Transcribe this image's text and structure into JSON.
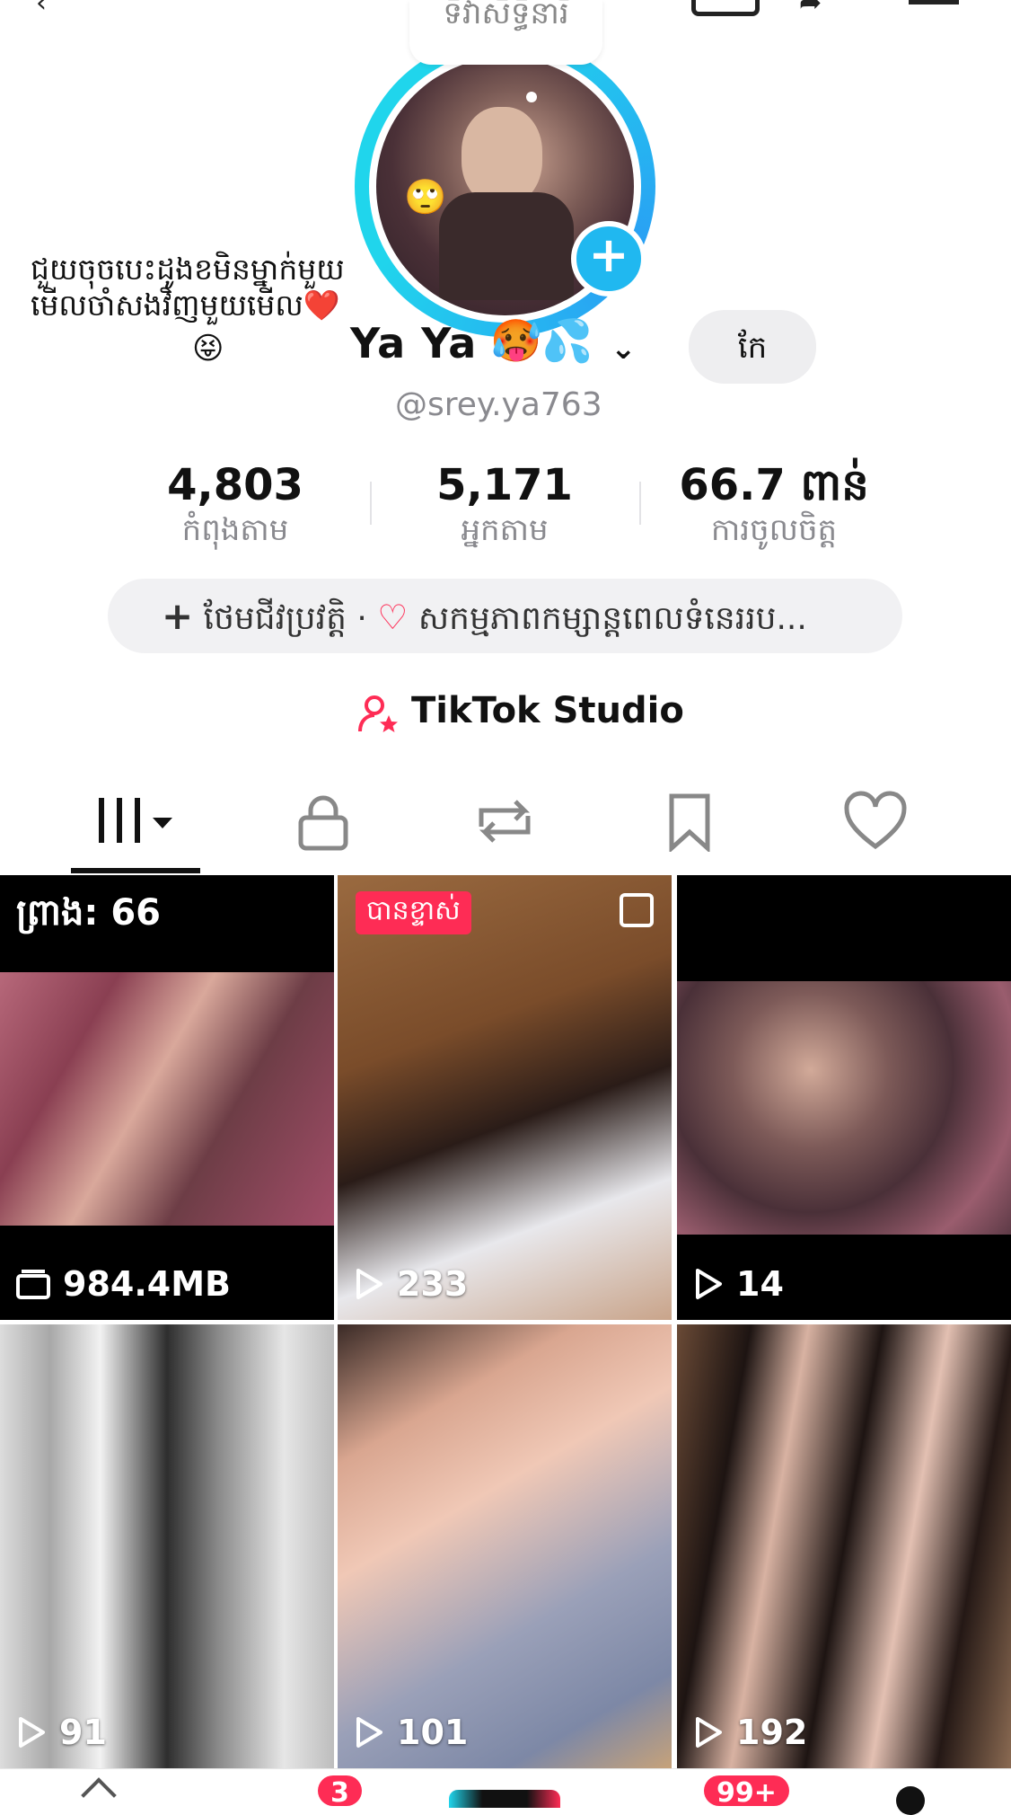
{
  "note": {
    "text": "ទិវាសិទ្ធិនារី"
  },
  "bio": {
    "text": "ជួយចុចបេះដូងខមិនម្នាក់មួយ មើលចាំសងវិញមួយមើល❤️",
    "emoji": "😝"
  },
  "profile": {
    "name": "Ya Ya",
    "name_emoji": "🥵💦",
    "handle": "@srey.ya763",
    "edit_label": "កែ",
    "avatar_emoji": "🙄"
  },
  "stats": [
    {
      "value": "4,803",
      "label": "កំពុងតាម"
    },
    {
      "value": "5,171",
      "label": "អ្នកតាម"
    },
    {
      "value": "66.7 ពាន់",
      "label": "ការចូលចិត្ត"
    }
  ],
  "bio_pill": {
    "add_bio": "ថែមជីវប្រវត្តិ",
    "separator": "·",
    "activity": "សកម្មភាពកម្សាន្តពេលទំនេររប..."
  },
  "studio": {
    "label": "TikTok Studio"
  },
  "tabs": [
    "videos-grid",
    "private",
    "reposts",
    "favorites",
    "liked"
  ],
  "grid": [
    {
      "top_label": "ព្រាង: 66",
      "stat": "984.4MB",
      "stat_icon": "storage-icon",
      "photo": "a"
    },
    {
      "tag": "បានខ្ទាស់",
      "stat": "233",
      "stat_icon": "play-icon",
      "photo": "b",
      "multi": true
    },
    {
      "stat": "14",
      "stat_icon": "play-icon",
      "photo": "c"
    },
    {
      "stat": "91",
      "stat_icon": "play-icon",
      "photo": "d"
    },
    {
      "stat": "101",
      "stat_icon": "play-icon",
      "photo": "e"
    },
    {
      "stat": "192",
      "stat_icon": "play-icon",
      "photo": "f"
    }
  ],
  "nav_badges": {
    "inbox": "3",
    "notifications": "99+"
  },
  "colors": {
    "accent": "#fe2c55",
    "ring": "#20d5ec",
    "add": "#20b8f0"
  }
}
